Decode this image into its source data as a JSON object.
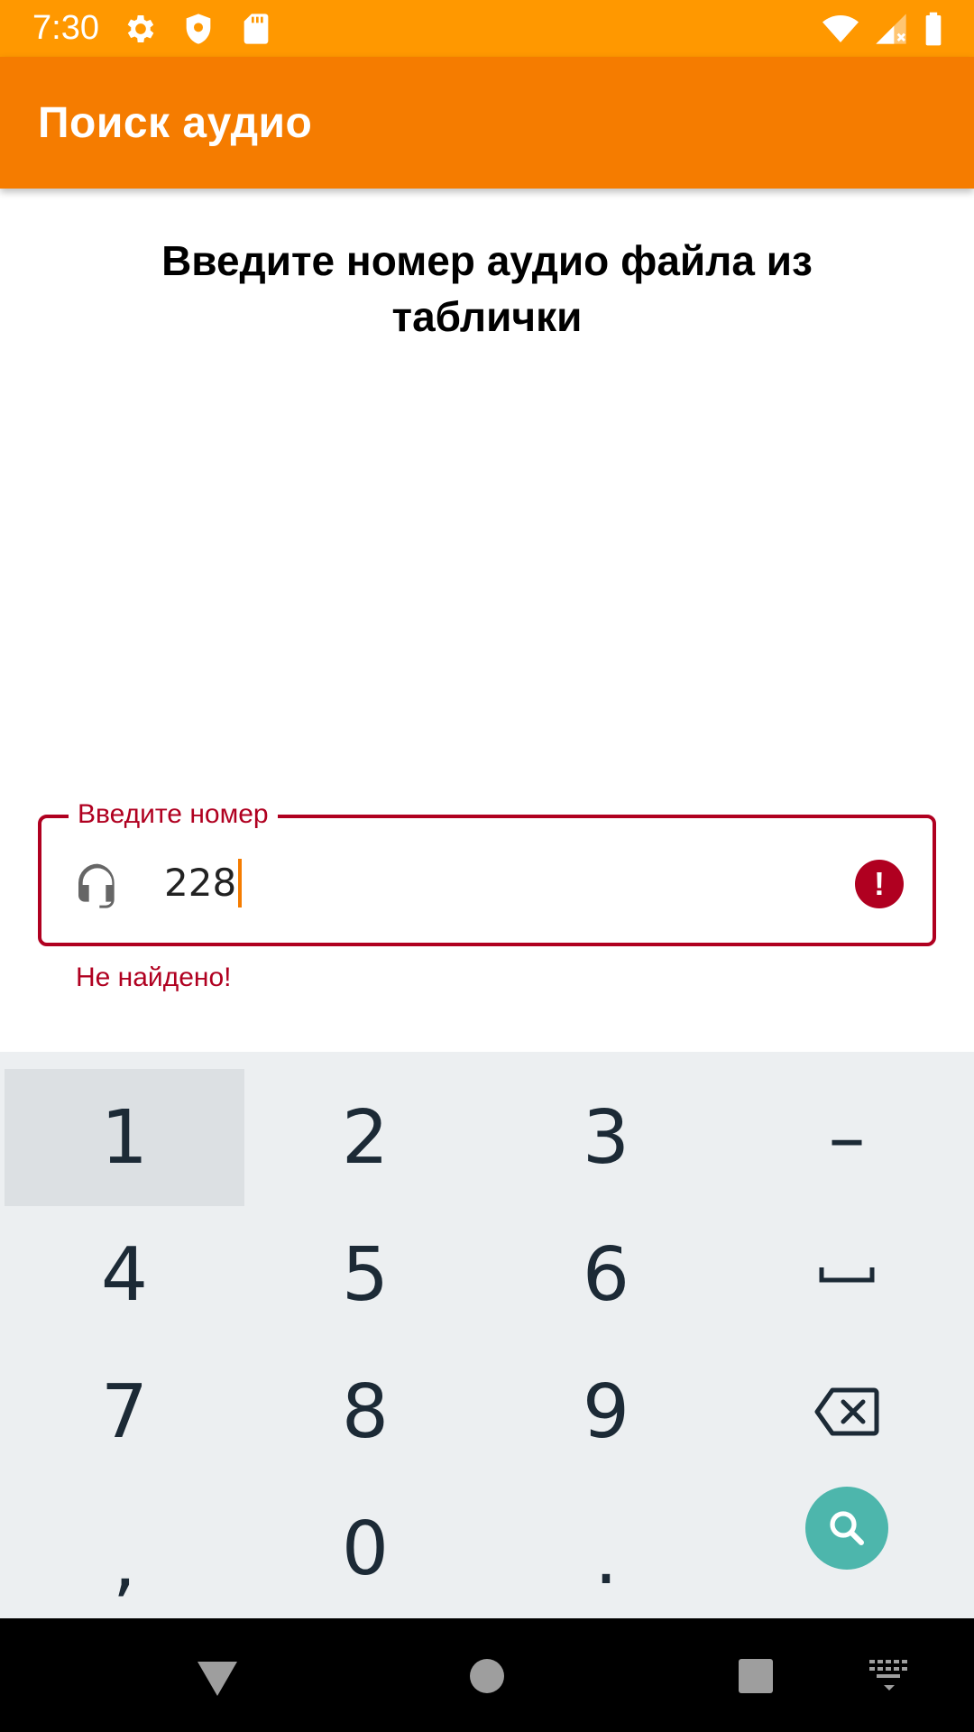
{
  "status_bar": {
    "time": "7:30",
    "icons_left": [
      "gear-icon",
      "shield-icon",
      "sd-card-icon"
    ],
    "icons_right": [
      "wifi-icon",
      "signal-icon",
      "battery-icon"
    ]
  },
  "app_bar": {
    "title": "Поиск аудио"
  },
  "main": {
    "instruction": "Введите номер аудио файла из таблички",
    "field": {
      "label": "Введите номер",
      "value": "228",
      "leading_icon": "headset-icon",
      "trailing_icon": "error-icon",
      "error_icon_glyph": "!",
      "error_text": "Не найдено!"
    }
  },
  "keyboard": {
    "rows": [
      [
        "1",
        "2",
        "3",
        "–"
      ],
      [
        "4",
        "5",
        "6",
        "space"
      ],
      [
        "7",
        "8",
        "9",
        "backspace"
      ],
      [
        ",",
        "0",
        ".",
        "search"
      ]
    ],
    "pressed_key": "1",
    "accent_color": "#4DB6AC"
  },
  "nav_bar": {
    "buttons": [
      "back-icon",
      "home-icon",
      "recents-icon",
      "keyboard-switch-icon"
    ]
  },
  "colors": {
    "status_bar": "#FF9800",
    "app_bar": "#F57C00",
    "error": "#B00020",
    "keyboard_bg": "#ECEFF1"
  }
}
